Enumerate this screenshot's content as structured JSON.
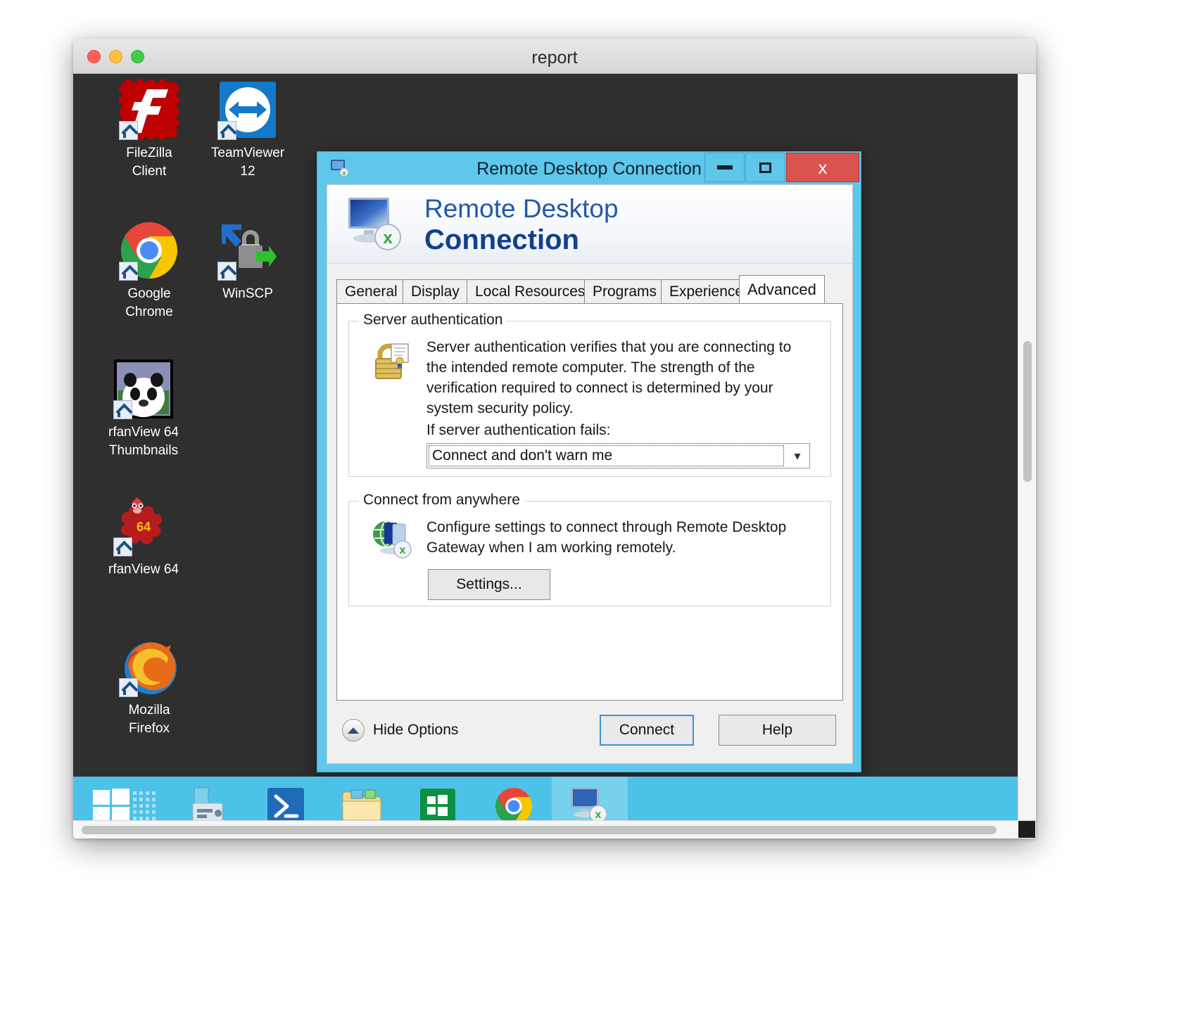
{
  "mac_window": {
    "title": "report",
    "traffic_lights": [
      {
        "name": "close",
        "color": "#fc6058"
      },
      {
        "name": "minimize",
        "color": "#fec041"
      },
      {
        "name": "zoom",
        "color": "#3ecc49"
      }
    ]
  },
  "desktop": {
    "background": "#2f2f2f",
    "icons": [
      {
        "label": "FileZilla\nClient",
        "label_line1": "FileZilla",
        "label_line2": "Client",
        "icon": "filezilla-icon"
      },
      {
        "label": "TeamViewer 12",
        "label_line1": "TeamViewer",
        "label_line2": "12",
        "icon": "teamviewer-icon"
      },
      {
        "label": "Google Chrome",
        "label_line1": "Google",
        "label_line2": "Chrome",
        "icon": "google-chrome-icon"
      },
      {
        "label": "WinSCP",
        "label_line1": "WinSCP",
        "label_line2": "",
        "icon": "winscp-icon"
      },
      {
        "label": "IrfanView 64 Thumbnails",
        "label_line1": "rfanView 64",
        "label_line2": "Thumbnails",
        "icon": "irfanview-thumbnails-icon"
      },
      {
        "label": "IrfanView 64",
        "label_line1": "rfanView 64",
        "label_line2": "",
        "icon": "irfanview-icon"
      },
      {
        "label": "Mozilla Firefox",
        "label_line1": "Mozilla",
        "label_line2": "Firefox",
        "icon": "mozilla-firefox-icon"
      }
    ]
  },
  "taskbar": {
    "background": "#4dc2e8",
    "items": [
      {
        "name": "start-button",
        "icon": "windows-logo-icon"
      },
      {
        "name": "show-desktop-grid",
        "icon": "dots-grid-icon"
      },
      {
        "name": "server-manager",
        "icon": "server-manager-icon"
      },
      {
        "name": "powershell",
        "icon": "powershell-icon"
      },
      {
        "name": "file-explorer",
        "icon": "file-explorer-icon"
      },
      {
        "name": "store",
        "icon": "windows-store-icon"
      },
      {
        "name": "chrome",
        "icon": "google-chrome-icon"
      },
      {
        "name": "remote-desktop-connection",
        "icon": "remote-desktop-icon",
        "active": true
      }
    ]
  },
  "rdc": {
    "window_title": "Remote Desktop Connection",
    "window_buttons": {
      "minimize": "–",
      "maximize": "□",
      "close": "x"
    },
    "banner": {
      "line1": "Remote Desktop",
      "line2": "Connection"
    },
    "tabs": [
      {
        "label": "General",
        "selected": false
      },
      {
        "label": "Display",
        "selected": false
      },
      {
        "label": "Local Resources",
        "selected": false
      },
      {
        "label": "Programs",
        "selected": false
      },
      {
        "label": "Experience",
        "selected": false
      },
      {
        "label": "Advanced",
        "selected": true
      }
    ],
    "server_authentication": {
      "legend": "Server authentication",
      "description": "Server authentication verifies that you are connecting to the intended remote computer. The strength of the verification required to connect is determined by your system security policy.",
      "prompt": "If server authentication fails:",
      "combo_value": "Connect and don't warn me"
    },
    "connect_from_anywhere": {
      "legend": "Connect from anywhere",
      "description": "Configure settings to connect through Remote Desktop Gateway when I am working remotely.",
      "settings_button": "Settings..."
    },
    "footer": {
      "hide_options": "Hide Options",
      "connect_button": "Connect",
      "help_button": "Help"
    },
    "colors": {
      "titlebar": "#5ec7ea",
      "close_button": "#d9534f",
      "banner_text": "#1a4a9c",
      "default_button_border": "#3c93d0"
    }
  }
}
